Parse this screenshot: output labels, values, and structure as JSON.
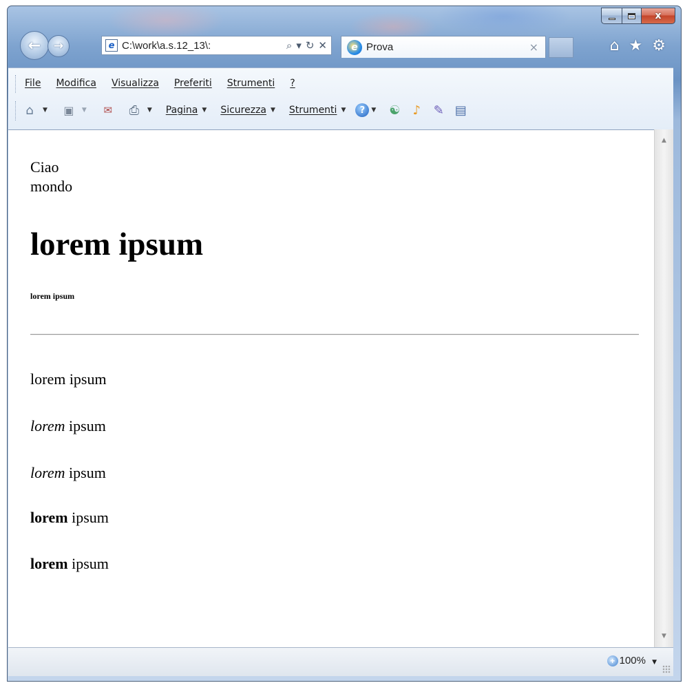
{
  "window": {
    "caption": {
      "minimize": "–",
      "maximize": "□",
      "close": "x"
    }
  },
  "nav": {
    "back_icon": "arrow-left",
    "forward_icon": "arrow-right",
    "address": "C:\\work\\a.s.12_13\\:",
    "address_tools": {
      "search": "⌕",
      "dropdown": "▾",
      "refresh": "↻",
      "stop": "✕"
    },
    "tab_title": "Prova",
    "tab_close": "×"
  },
  "toolbar_icons": {
    "home": "⌂",
    "favorites": "★",
    "tools": "⚙"
  },
  "menu": [
    "File",
    "Modifica",
    "Visualizza",
    "Preferiti",
    "Strumenti",
    "?"
  ],
  "command_bar": {
    "page": "Pagina",
    "safety": "Sicurezza",
    "tools": "Strumenti"
  },
  "content": {
    "line1": "Ciao",
    "line2": "mondo",
    "h1": "lorem ipsum",
    "h6": "lorem ipsum",
    "paragraphs": [
      {
        "emph": "",
        "rest": "lorem ipsum"
      },
      {
        "emph": "lorem",
        "rest": " ipsum"
      },
      {
        "emph": "lorem",
        "rest": " ipsum"
      },
      {
        "emph": "lorem",
        "rest": " ipsum"
      },
      {
        "emph": "lorem",
        "rest": " ipsum"
      }
    ]
  },
  "status": {
    "zoom": "100%"
  }
}
